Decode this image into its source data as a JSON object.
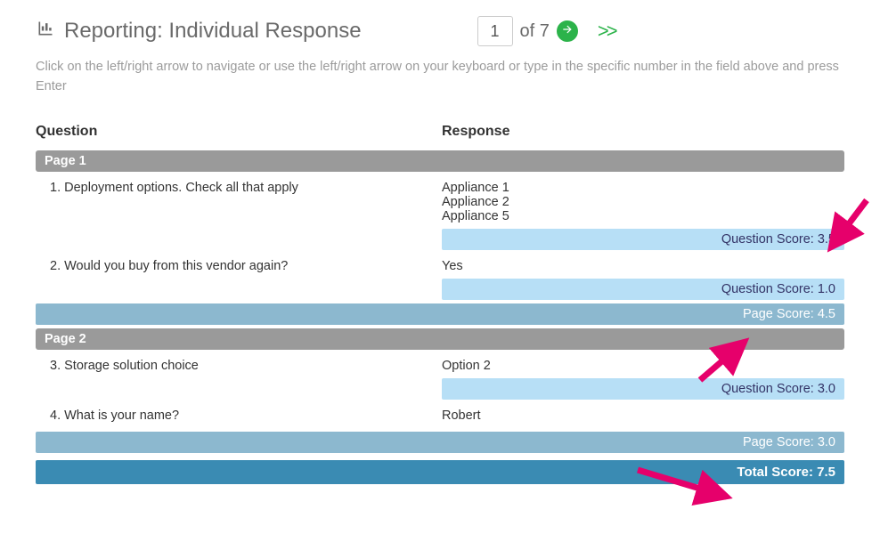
{
  "header": {
    "title": "Reporting: Individual Response",
    "current": "1",
    "of_label": "of 7",
    "next_icon": "arrow-right",
    "fast_fwd": ">>"
  },
  "instructions": "Click on the left/right arrow to navigate or use the left/right arrow on your keyboard or type in the specific number in the field above and press Enter",
  "columns": {
    "question": "Question",
    "response": "Response"
  },
  "labels": {
    "question_score_prefix": "Question Score: ",
    "page_score_prefix": "Page Score: ",
    "total_score_prefix": "Total Score: "
  },
  "pages": [
    {
      "name": "Page 1",
      "questions": [
        {
          "q": "1. Deployment options.  Check all that apply",
          "r": "Appliance 1\nAppliance 2\nAppliance 5",
          "score": "3.5"
        },
        {
          "q": "2. Would you buy from this vendor again?",
          "r": "Yes",
          "score": "1.0"
        }
      ],
      "page_score": "4.5"
    },
    {
      "name": "Page 2",
      "questions": [
        {
          "q": "3. Storage solution choice",
          "r": "Option 2",
          "score": "3.0"
        },
        {
          "q": "4. What is your name?",
          "r": "Robert",
          "score": null
        }
      ],
      "page_score": "3.0"
    }
  ],
  "total_score": "7.5",
  "annotations": {
    "arrow_color": "#e6006b"
  }
}
